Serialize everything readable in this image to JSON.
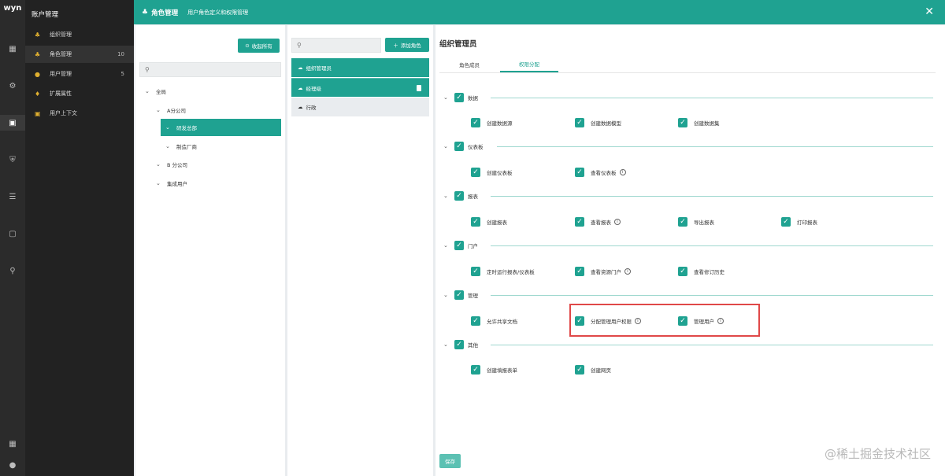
{
  "app": {
    "logo": "wyn"
  },
  "menu": {
    "title": "账户管理",
    "items": [
      {
        "label": "组织管理",
        "count": ""
      },
      {
        "label": "角色管理",
        "count": "10"
      },
      {
        "label": "用户管理",
        "count": "5"
      },
      {
        "label": "扩展属性",
        "count": ""
      },
      {
        "label": "用户上下文",
        "count": ""
      }
    ]
  },
  "header": {
    "title": "角色管理",
    "subtitle": "用户角色定义和权限管理",
    "close": "✕"
  },
  "org_panel": {
    "collapse_all": "收起所有",
    "tree": [
      {
        "label": "全局"
      },
      {
        "label": "A分公司"
      },
      {
        "label": "研发总部"
      },
      {
        "label": "制造厂商"
      },
      {
        "label": "B 分公司"
      },
      {
        "label": "集成用户"
      }
    ]
  },
  "roles_panel": {
    "add_role": "添加角色",
    "roles": [
      {
        "label": "组织管理员"
      },
      {
        "label": "经理级"
      },
      {
        "label": "行政"
      }
    ]
  },
  "perm_panel": {
    "title": "组织管理员",
    "tabs": [
      "角色成员",
      "权限分配"
    ],
    "groups": [
      {
        "label": "数据",
        "perms": [
          "创建数据源",
          "创建数据模型",
          "创建数据集"
        ]
      },
      {
        "label": "仪表板",
        "perms": [
          "创建仪表板",
          "查看仪表板"
        ]
      },
      {
        "label": "报表",
        "perms": [
          "创建报表",
          "查看报表",
          "导出报表",
          "打印报表"
        ]
      },
      {
        "label": "门户",
        "perms": [
          "定时运行报表/仪表板",
          "查看资源门户",
          "查看修订历史"
        ]
      },
      {
        "label": "管理",
        "perms": [
          "允许共享文档",
          "分配管理用户权限",
          "管理用户"
        ]
      },
      {
        "label": "其他",
        "perms": [
          "创建填报表单",
          "创建网页"
        ]
      }
    ],
    "save": "保存"
  },
  "watermark": "@稀土掘金技术社区",
  "colors": {
    "accent": "#1fa291",
    "highlight": "#e04848"
  }
}
